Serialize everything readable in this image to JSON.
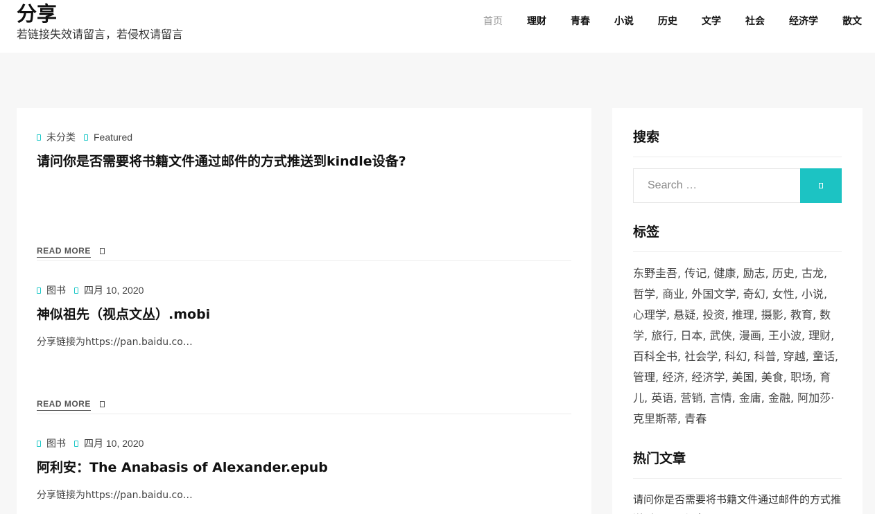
{
  "site": {
    "title": "分享",
    "tagline": "若链接失效请留言，若侵权请留言"
  },
  "nav": {
    "items": [
      "首页",
      "理财",
      "青春",
      "小说",
      "历史",
      "文学",
      "社会",
      "经济学",
      "散文"
    ],
    "active": "首页"
  },
  "posts": [
    {
      "meta": [
        "未分类",
        "Featured"
      ],
      "title": "请问你是否需要将书籍文件通过邮件的方式推送到kindle设备?",
      "excerpt": "",
      "read_more": "READ MORE"
    },
    {
      "meta": [
        "图书",
        "四月 10, 2020"
      ],
      "title": "神似祖先（视点文丛）.mobi",
      "excerpt": "分享链接为https://pan.baidu.co…",
      "read_more": "READ MORE"
    },
    {
      "meta": [
        "图书",
        "四月 10, 2020"
      ],
      "title": "阿利安：The Anabasis of Alexander.epub",
      "excerpt": "分享链接为https://pan.baidu.co…"
    }
  ],
  "sidebar": {
    "search_title": "搜索",
    "search_placeholder": "Search …",
    "tags_title": "标签",
    "tags": [
      "东野圭吾",
      "传记",
      "健康",
      "励志",
      "历史",
      "古龙",
      "哲学",
      "商业",
      "外国文学",
      "奇幻",
      "女性",
      "小说",
      "心理学",
      "悬疑",
      "投资",
      "推理",
      "摄影",
      "教育",
      "数学",
      "旅行",
      "日本",
      "武侠",
      "漫画",
      "王小波",
      "理财",
      "百科全书",
      "社会学",
      "科幻",
      "科普",
      "穿越",
      "童话",
      "管理",
      "经济",
      "经济学",
      "美国",
      "美食",
      "职场",
      "育儿",
      "英语",
      "营销",
      "言情",
      "金庸",
      "金融",
      "阿加莎·克里斯蒂",
      "青春"
    ],
    "hot_title": "热门文章",
    "hot_posts": [
      "请问你是否需要将书籍文件通过邮件的方式推送到kindle设备?"
    ]
  },
  "colors": {
    "accent": "#1cc3c3",
    "page_bg": "#f7f7f7",
    "card_bg": "#ffffff"
  },
  "icons": {
    "meta": "category-icon",
    "read_more": "arrow-right-icon",
    "search": "search-icon"
  }
}
